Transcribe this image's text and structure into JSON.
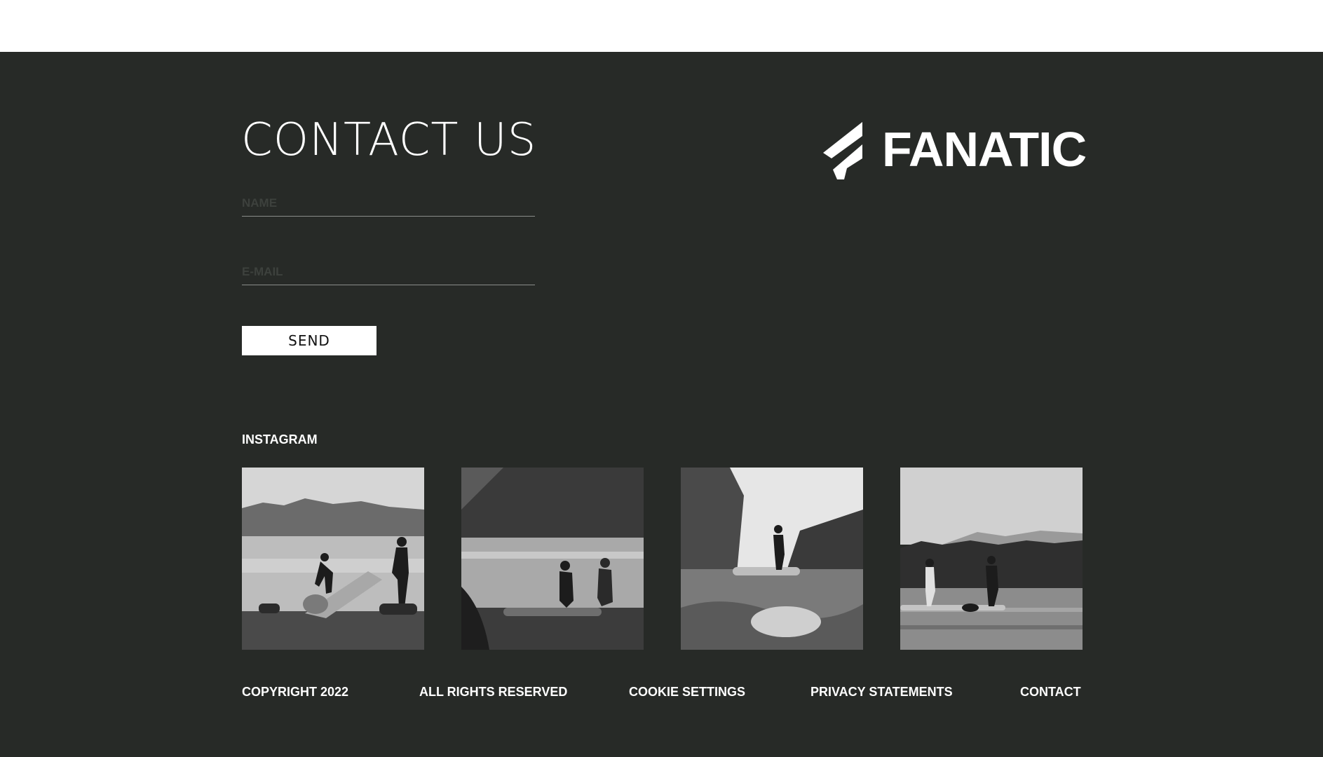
{
  "contact": {
    "title": "CONTACT US",
    "name_placeholder": "NAME",
    "email_placeholder": "E-MAIL",
    "send_label": "SEND"
  },
  "brand": {
    "name": "FANATIC",
    "logo_icon": "fanatic-f-mark-icon"
  },
  "instagram": {
    "label": "INSTAGRAM",
    "posts": [
      {
        "image": "two-people-unrolling-paddleboard-on-lakeshore"
      },
      {
        "image": "two-people-kneeling-by-board-at-lake-with-mountain"
      },
      {
        "image": "person-standing-on-paddleboard-in-forest-lake"
      },
      {
        "image": "two-paddlers-standing-on-boards-lake-mountains"
      }
    ]
  },
  "footer": {
    "links": [
      "COPYRIGHT 2022",
      "ALL RIGHTS RESERVED",
      "COOKIE SETTINGS",
      "PRIVACY STATEMENTS",
      "CONTACT"
    ]
  },
  "colors": {
    "background": "#272a27",
    "text": "#ffffff",
    "button_bg": "#ffffff",
    "field_underline": "#8a8d8a"
  }
}
